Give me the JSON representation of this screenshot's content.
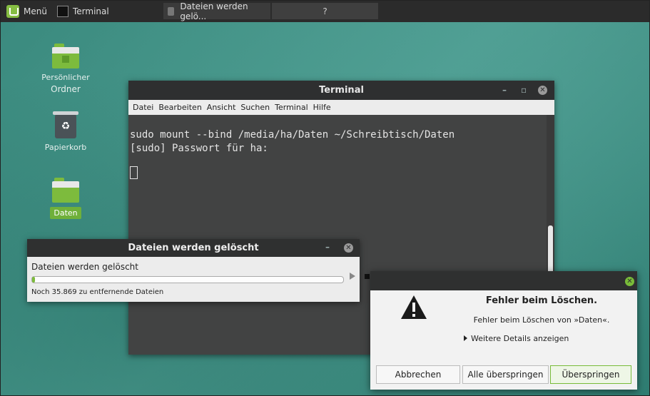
{
  "taskbar": {
    "menu_label": "Menü",
    "terminal_label": "Terminal",
    "task_delete_label": "Dateien werden gelö...",
    "task_error_label": "?"
  },
  "desktop_icons": [
    {
      "label_line1": "Persönlicher",
      "label_line2": "Ordner",
      "icon": "home-folder-icon"
    },
    {
      "label": "Papierkorb",
      "icon": "trash-icon"
    },
    {
      "label": "Daten",
      "icon": "folder-icon"
    }
  ],
  "terminal": {
    "title": "Terminal",
    "menu": [
      "Datei",
      "Bearbeiten",
      "Ansicht",
      "Suchen",
      "Terminal",
      "Hilfe"
    ],
    "lines": [
      "sudo mount --bind /media/ha/Daten ~/Schreibtisch/Daten",
      "[sudo] Passwort für ha:"
    ]
  },
  "delete_dialog": {
    "title": "Dateien werden gelöscht",
    "status": "Dateien werden gelöscht",
    "progress": 0.01,
    "remaining": "Noch 35.869 zu entfernende Dateien"
  },
  "error_dialog": {
    "heading": "Fehler beim Löschen.",
    "message": "Fehler beim Löschen von »Daten«.",
    "details_label": "Weitere Details anzeigen",
    "buttons": {
      "cancel": "Abbrechen",
      "skip_all": "Alle überspringen",
      "skip": "Überspringen"
    }
  },
  "colors": {
    "accent": "#79bc39",
    "panel": "#2b2b2b",
    "desktop": "#3f8f83"
  }
}
